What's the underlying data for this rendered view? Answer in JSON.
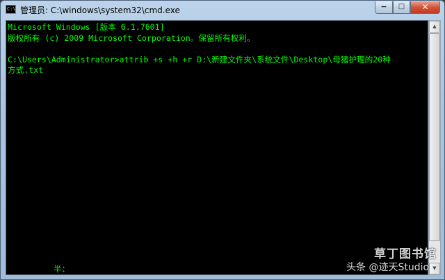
{
  "window": {
    "title": "管理员: C:\\windows\\system32\\cmd.exe",
    "icon_text": "C:\\",
    "controls": {
      "minimize_glyph": "−",
      "maximize_glyph": "□",
      "close_glyph": "✕"
    }
  },
  "console": {
    "lines": [
      "Microsoft Windows [版本 6.1.7601]",
      "版权所有 (c) 2009 Microsoft Corporation。保留所有权利。",
      "",
      "C:\\Users\\Administrator>attrib +s +h +r D:\\新建文件夹\\系统文件\\Desktop\\母猪护理的20种",
      "方式.txt"
    ],
    "ime_indicator": "半："
  },
  "scrollbar": {
    "up_glyph": "▲",
    "down_glyph": "▼"
  },
  "watermark": {
    "site": "草丁图书馆",
    "author": "头条 @迹天Studio"
  },
  "colors": {
    "console_text": "#00ff00",
    "console_background": "#000000"
  },
  "icons": [
    "cmd-app-icon",
    "minimize-icon",
    "maximize-icon",
    "close-icon",
    "scroll-up-arrow-icon",
    "scroll-down-arrow-icon"
  ]
}
